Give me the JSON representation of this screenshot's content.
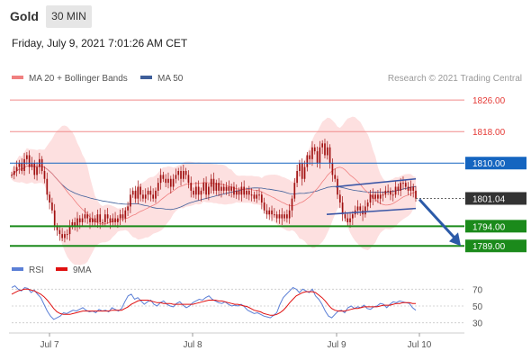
{
  "header": {
    "symbol": "Gold",
    "timeframe": "30 MIN"
  },
  "datetime": "Friday, July 9, 2021 7:01:26 AM CET",
  "legend": {
    "ma20": "MA 20 + Bollinger Bands",
    "ma50": "MA 50"
  },
  "copyright": "Research © 2021 Trading Central",
  "colors": {
    "resistance": "#e53935",
    "pivot": "#1565c0",
    "support": "#1b8a1b",
    "current": "#333333",
    "bollinger_fill": "#fde0e0",
    "ma20": "#f08080",
    "ma50": "#3f5f9a",
    "candle": "#a01010"
  },
  "chart_data": [
    {
      "type": "candlestick",
      "symbol": "Gold",
      "timeframe": "30 MIN",
      "x_labels": [
        "Jul 7",
        "Jul 8",
        "Jul 9",
        "Jul 10"
      ],
      "ylim": [
        1787,
        1829
      ],
      "levels": [
        {
          "label": "1826.00",
          "value": 1826.0,
          "kind": "resistance"
        },
        {
          "label": "1818.00",
          "value": 1818.0,
          "kind": "resistance"
        },
        {
          "label": "1810.00",
          "value": 1810.0,
          "kind": "pivot"
        },
        {
          "label": "1801.04",
          "value": 1801.04,
          "kind": "last-price"
        },
        {
          "label": "1794.00",
          "value": 1794.0,
          "kind": "support"
        },
        {
          "label": "1789.00",
          "value": 1789.0,
          "kind": "support"
        }
      ],
      "close": [
        1807,
        1808,
        1809,
        1810,
        1808,
        1811,
        1812,
        1809,
        1810,
        1807,
        1809,
        1811,
        1808,
        1806,
        1802,
        1800,
        1798,
        1794,
        1793,
        1792,
        1791,
        1792,
        1792,
        1794,
        1795,
        1794,
        1796,
        1795,
        1796,
        1797,
        1796,
        1795,
        1796,
        1795,
        1797,
        1795,
        1795,
        1797,
        1796,
        1795,
        1796,
        1795,
        1796,
        1797,
        1796,
        1798,
        1799,
        1802,
        1803,
        1801,
        1804,
        1802,
        1801,
        1802,
        1803,
        1802,
        1801,
        1803,
        1805,
        1807,
        1806,
        1805,
        1806,
        1804,
        1806,
        1807,
        1808,
        1806,
        1808,
        1807,
        1805,
        1803,
        1802,
        1804,
        1802,
        1803,
        1805,
        1802,
        1804,
        1806,
        1803,
        1805,
        1803,
        1804,
        1803,
        1804,
        1803,
        1804,
        1802,
        1803,
        1802,
        1804,
        1802,
        1803,
        1802,
        1802,
        1801,
        1802,
        1802,
        1800,
        1798,
        1797,
        1798,
        1797,
        1797,
        1796,
        1797,
        1796,
        1797,
        1796,
        1798,
        1801,
        1805,
        1808,
        1810,
        1806,
        1809,
        1812,
        1811,
        1814,
        1813,
        1810,
        1814,
        1815,
        1812,
        1814,
        1810,
        1807,
        1806,
        1802,
        1800,
        1797,
        1796,
        1795,
        1796,
        1797,
        1798,
        1799,
        1798,
        1797,
        1799,
        1800,
        1802,
        1801,
        1802,
        1801,
        1802,
        1802,
        1803,
        1803,
        1802,
        1802,
        1804,
        1803,
        1805,
        1805,
        1804,
        1803,
        1804,
        1803,
        1801
      ],
      "ma20_note": "MA 20 with Bollinger Bands",
      "rsi_panel": {
        "legend": [
          "RSI",
          "9MA"
        ],
        "ticks": [
          70,
          50,
          30
        ]
      },
      "annotations": [
        {
          "kind": "ascending-channel",
          "note": "channel drawn around recent rise"
        },
        {
          "kind": "forecast-arrow",
          "from": 1801,
          "to": 1789
        }
      ]
    },
    {
      "type": "line",
      "name": "RSI",
      "series": [
        {
          "name": "RSI",
          "values": [
            72,
            74,
            70,
            68,
            72,
            71,
            66,
            69,
            64,
            60,
            52,
            44,
            38,
            34,
            36,
            38,
            42,
            41,
            43,
            45,
            44,
            46,
            48,
            45,
            43,
            44,
            42,
            46,
            44,
            45,
            43,
            48,
            46,
            44,
            47,
            55,
            62,
            64,
            58,
            60,
            56,
            52,
            55,
            57,
            52,
            50,
            54,
            56,
            52,
            50,
            49,
            53,
            55,
            51,
            48,
            50,
            54,
            56,
            58,
            57,
            60,
            62,
            58,
            56,
            54,
            53,
            55,
            52,
            50,
            51,
            50,
            52,
            49,
            45,
            43,
            41,
            42,
            40,
            38,
            37,
            36,
            39,
            42,
            52,
            60,
            64,
            68,
            72,
            70,
            66,
            70,
            68,
            66,
            70,
            62,
            58,
            52,
            44,
            38,
            36,
            40,
            44,
            45,
            42,
            48,
            50,
            47,
            49,
            48,
            51,
            47,
            46,
            49,
            50,
            53,
            52,
            48,
            52,
            55,
            54,
            56,
            55,
            54,
            53,
            48,
            45
          ]
        },
        {
          "name": "9MA",
          "values": [
            64,
            66,
            68,
            69,
            70,
            70,
            69,
            68,
            66,
            64,
            61,
            57,
            52,
            47,
            43,
            41,
            40,
            40,
            40,
            41,
            42,
            43,
            44,
            44,
            44,
            44,
            44,
            44,
            44,
            44,
            44,
            45,
            45,
            45,
            45,
            47,
            49,
            52,
            54,
            56,
            57,
            57,
            57,
            56,
            55,
            54,
            54,
            53,
            53,
            53,
            52,
            52,
            52,
            52,
            52,
            52,
            52,
            53,
            54,
            55,
            56,
            57,
            57,
            57,
            56,
            56,
            55,
            54,
            53,
            52,
            52,
            51,
            50,
            49,
            47,
            45,
            44,
            43,
            41,
            40,
            39,
            39,
            40,
            42,
            45,
            49,
            54,
            58,
            62,
            64,
            66,
            67,
            67,
            67,
            66,
            63,
            60,
            56,
            51,
            47,
            45,
            44,
            44,
            44,
            45,
            46,
            47,
            47,
            48,
            49,
            49,
            49,
            49,
            49,
            50,
            51,
            51,
            51,
            52,
            53,
            53,
            54,
            54,
            54,
            53,
            53
          ]
        }
      ],
      "ylim": [
        20,
        80
      ]
    }
  ]
}
